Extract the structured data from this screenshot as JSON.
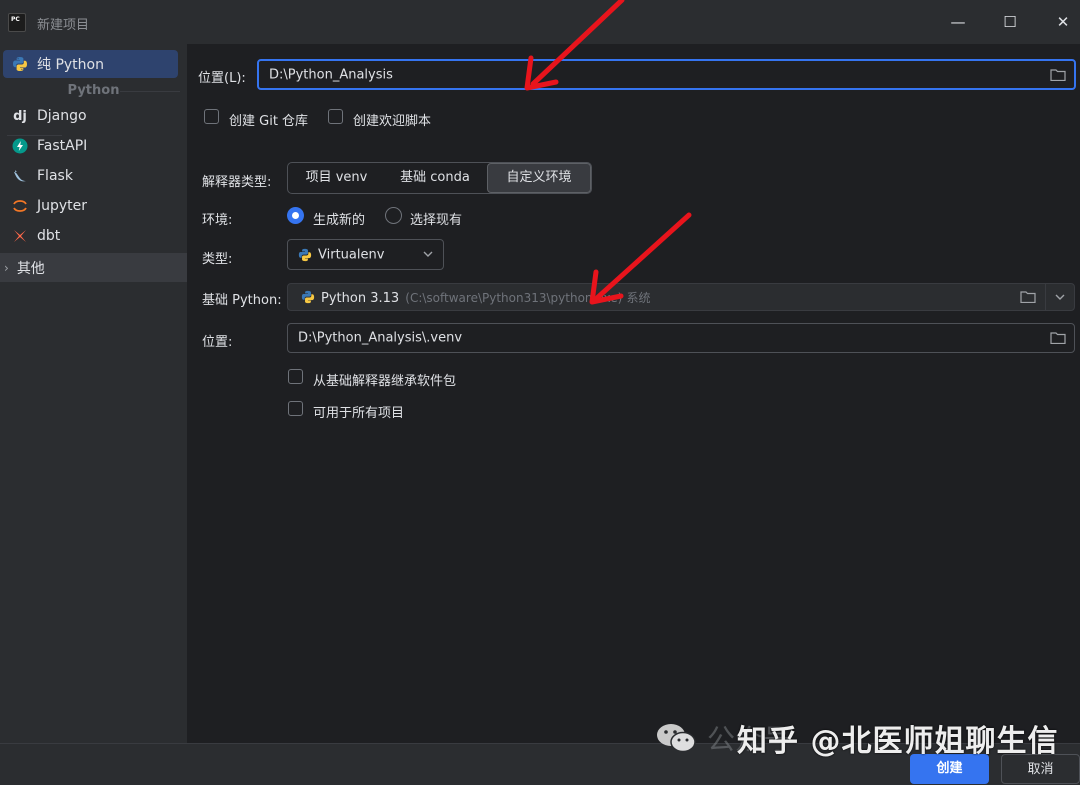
{
  "window": {
    "title": "新建项目",
    "controls": {
      "minimize": "—",
      "maximize": "☐",
      "close": "✕"
    }
  },
  "sidebar": {
    "items": [
      {
        "label": "纯 Python",
        "icon": "python-icon",
        "selected": true
      },
      {
        "label": "Django",
        "icon": "django-icon"
      },
      {
        "label": "FastAPI",
        "icon": "fastapi-icon"
      },
      {
        "label": "Flask",
        "icon": "flask-icon"
      },
      {
        "label": "Jupyter",
        "icon": "jupyter-icon"
      },
      {
        "label": "dbt",
        "icon": "dbt-icon"
      }
    ],
    "group_label": "Python",
    "django_icon_text": "dj",
    "other": {
      "label": "其他",
      "chevron": "›"
    }
  },
  "form": {
    "location_label": "位置(L):",
    "location_value": "D:\\Python_Analysis",
    "git_checkbox_label": "创建 Git 仓库",
    "welcome_checkbox_label": "创建欢迎脚本",
    "interpreter_type_label": "解释器类型:",
    "interpreter_tabs": [
      "项目 venv",
      "基础 conda",
      "自定义环境"
    ],
    "interpreter_tab_active": "自定义环境",
    "env_label": "环境:",
    "env_options": [
      "生成新的",
      "选择现有"
    ],
    "env_selected": "生成新的",
    "type_label": "类型:",
    "type_value": "Virtualenv",
    "base_python_label": "基础 Python:",
    "base_python_value": "Python 3.13",
    "base_python_path": "C:\\software\\Python313\\python.exe",
    "base_python_suffix": "系统",
    "venv_location_label": "位置:",
    "venv_location_value": "D:\\Python_Analysis\\.venv",
    "inherit_label": "从基础解释器继承软件包",
    "all_projects_label": "可用于所有项目"
  },
  "footer": {
    "create_label": "创建",
    "cancel_label": "取消"
  },
  "watermark": {
    "faint": "公众号",
    "text": "知乎 @北医师姐聊生信"
  },
  "colors": {
    "accent": "#3574f0",
    "arrow": "#e8141c",
    "selection": "#2e436e"
  }
}
